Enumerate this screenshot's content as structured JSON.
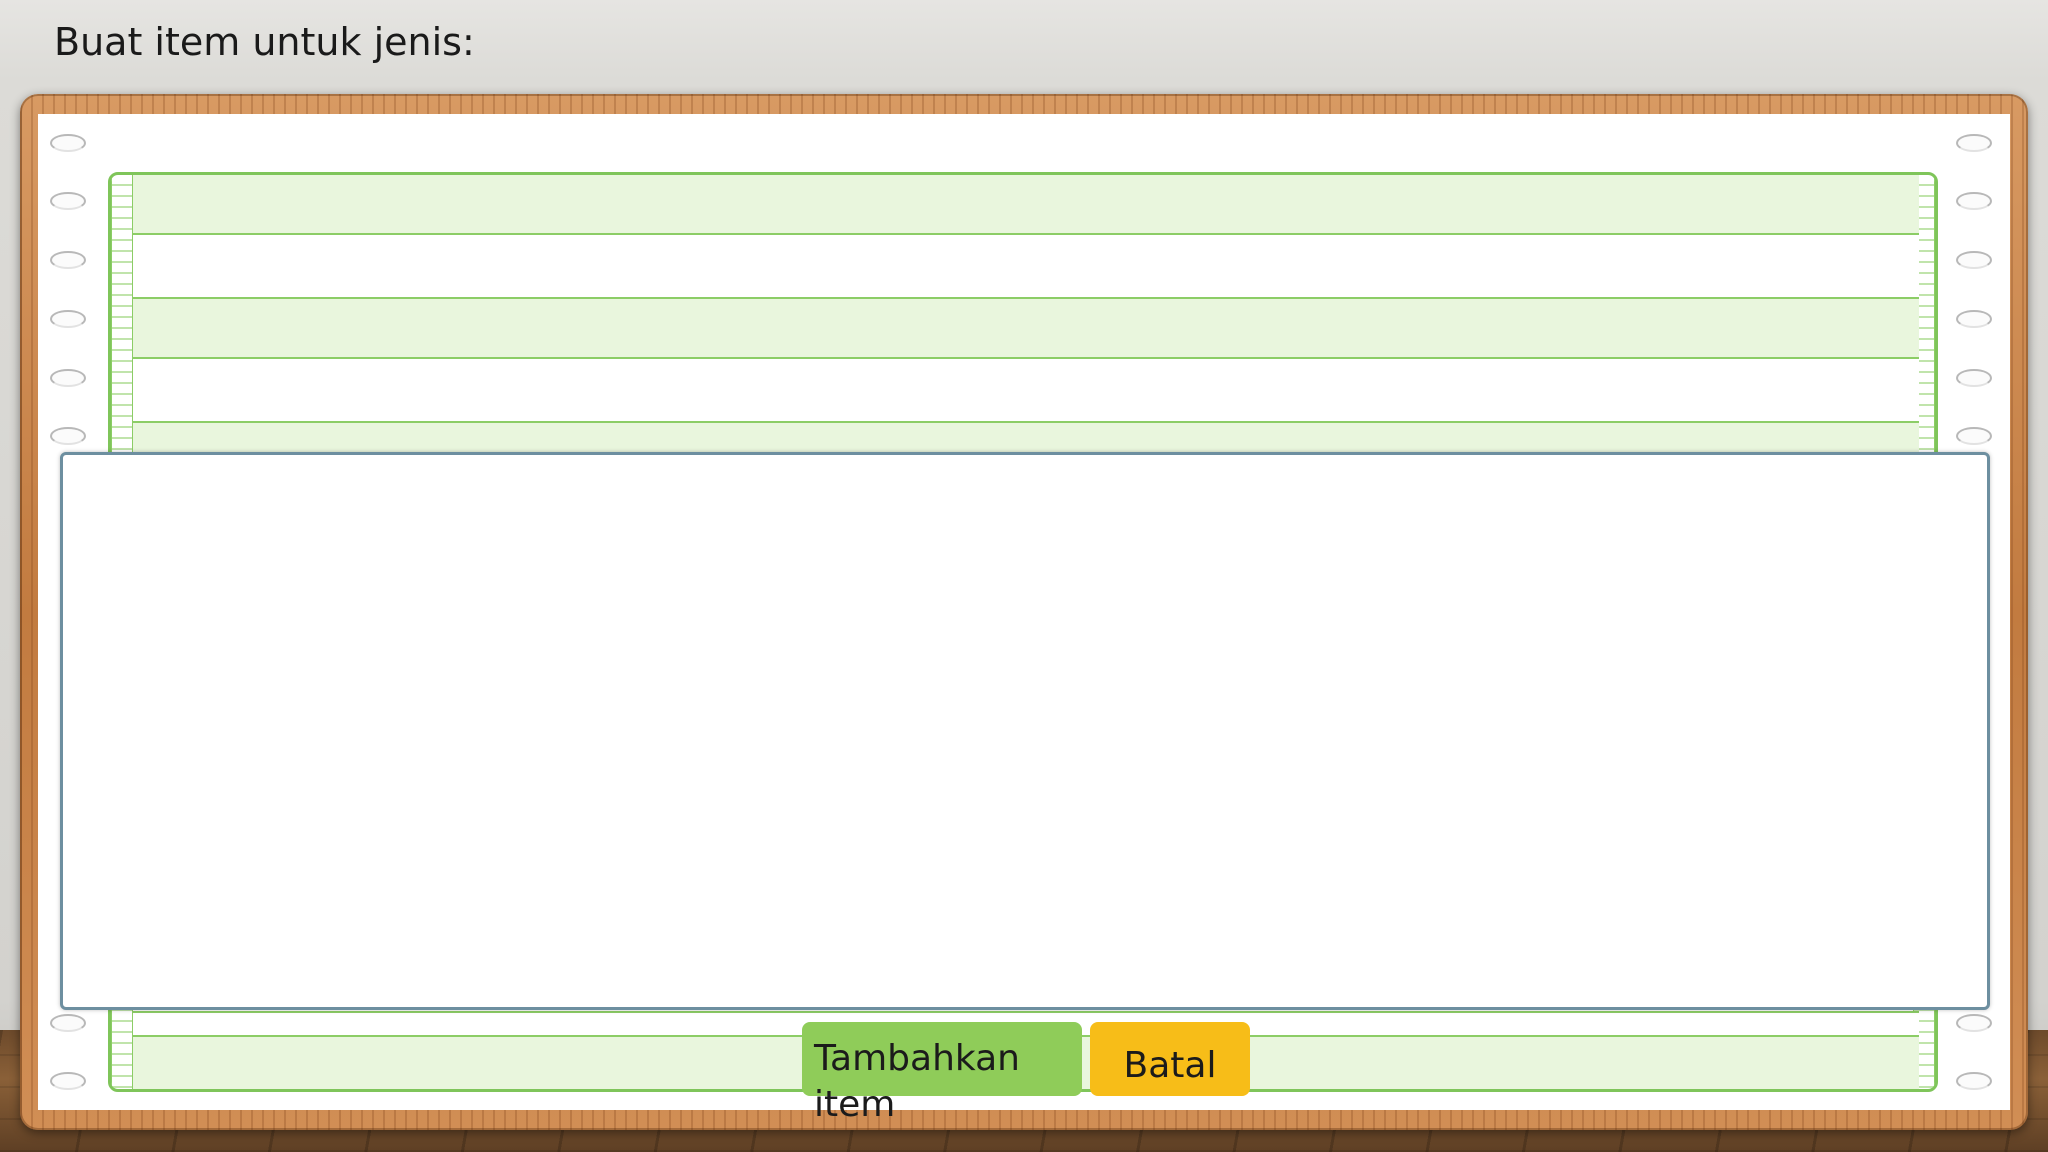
{
  "page": {
    "title": "Buat item untuk jenis:"
  },
  "dialog": {
    "add_button_label": "Tambahkan item",
    "cancel_button_label": "Batal"
  },
  "colors": {
    "add_button": "#8fcc59",
    "cancel_button": "#f7bd18",
    "form_band": "#e9f6dd",
    "form_line": "#8ccd66",
    "board_wood": "#c27b40"
  }
}
